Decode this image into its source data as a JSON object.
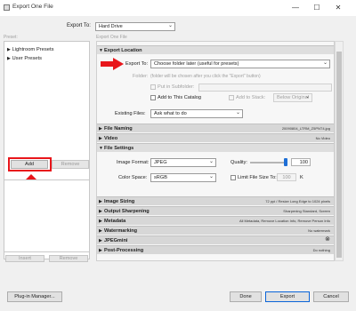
{
  "window": {
    "title": "Export One File",
    "controls": {
      "minimize": "—",
      "maximize": "☐",
      "close": "✕"
    }
  },
  "export_to_top": {
    "label": "Export To:",
    "value": "Hard Drive"
  },
  "left": {
    "preset_heading": "Preset:",
    "presets": [
      {
        "label": "Lightroom Presets"
      },
      {
        "label": "User Presets"
      }
    ],
    "add_label": "Add",
    "remove_label": "Remove",
    "insert_label": "Insert",
    "remove2_label": "Remove",
    "plugin_manager_label": "Plug-in Manager..."
  },
  "right": {
    "heading": "Export One File",
    "sections": {
      "export_location": {
        "title": "Export Location",
        "export_to_label": "Export To:",
        "export_to_value": "Choose folder later (useful for presets)",
        "folder_label": "Folder:",
        "folder_value": "(folder will be chosen after you click the \"Export\" button)",
        "subfolder_label": "Put in Subfolder:",
        "add_to_catalog_label": "Add to This Catalog",
        "add_to_stack_label": "Add to Stack:",
        "stack_value": "Below Original",
        "existing_files_label": "Existing Files:",
        "existing_files_value": "Ask what to do"
      },
      "file_naming": {
        "title": "File Naming",
        "summary": "20090804_LTRM_Z5PNT4.jpg"
      },
      "video": {
        "title": "Video",
        "summary": "No Video"
      },
      "file_settings": {
        "title": "File Settings",
        "image_format_label": "Image Format:",
        "image_format_value": "JPEG",
        "quality_label": "Quality:",
        "quality_value": "100",
        "quality_fraction": 1.0,
        "color_space_label": "Color Space:",
        "color_space_value": "sRGB",
        "limit_size_label": "Limit File Size To:",
        "limit_size_value": "100",
        "limit_size_unit": "K"
      },
      "image_sizing": {
        "title": "Image Sizing",
        "summary": "72 ppi / Resize Long Edge to 1024 pixels"
      },
      "output_sharpening": {
        "title": "Output Sharpening",
        "summary": "Sharpening Standard, Screen"
      },
      "metadata": {
        "title": "Metadata",
        "summary": "All Metadata, Remove Location Info, Remove Person Info"
      },
      "watermarking": {
        "title": "Watermarking",
        "summary": "No watermark"
      },
      "jpegmini": {
        "title": "JPEGmini",
        "summary": ""
      },
      "post_processing": {
        "title": "Post-Processing",
        "summary": "Do nothing"
      }
    }
  },
  "footer": {
    "done_label": "Done",
    "export_label": "Export",
    "cancel_label": "Cancel"
  },
  "colors": {
    "annotation_red": "#e8161b",
    "blue_thumb": "#1e6fd6"
  }
}
